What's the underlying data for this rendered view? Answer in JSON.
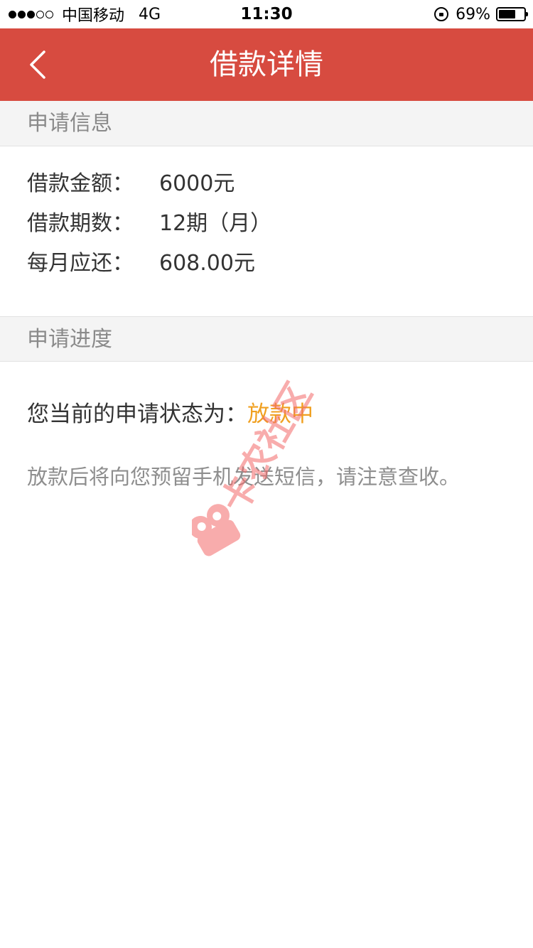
{
  "status_bar": {
    "carrier": "中国移动",
    "network": "4G",
    "time": "11:30",
    "battery_pct_text": "69%",
    "battery_level": 0.69,
    "signal_filled": 3,
    "signal_total": 5
  },
  "nav": {
    "title": "借款详情"
  },
  "application_info": {
    "section_label": "申请信息",
    "rows": [
      {
        "key": "借款金额：",
        "value": "6000元"
      },
      {
        "key": "借款期数：",
        "value": "12期（月）"
      },
      {
        "key": "每月应还：",
        "value": "608.00元"
      }
    ]
  },
  "application_progress": {
    "section_label": "申请进度",
    "status_prefix": "您当前的申请状态为：",
    "status_value": "放款中",
    "notice": "放款后将向您预留手机发送短信，请注意查收。"
  },
  "watermark": {
    "text": "卡农社区"
  },
  "colors": {
    "nav_bg": "#d74b40",
    "status_accent": "#f0a020",
    "watermark": "#f36a6a"
  }
}
